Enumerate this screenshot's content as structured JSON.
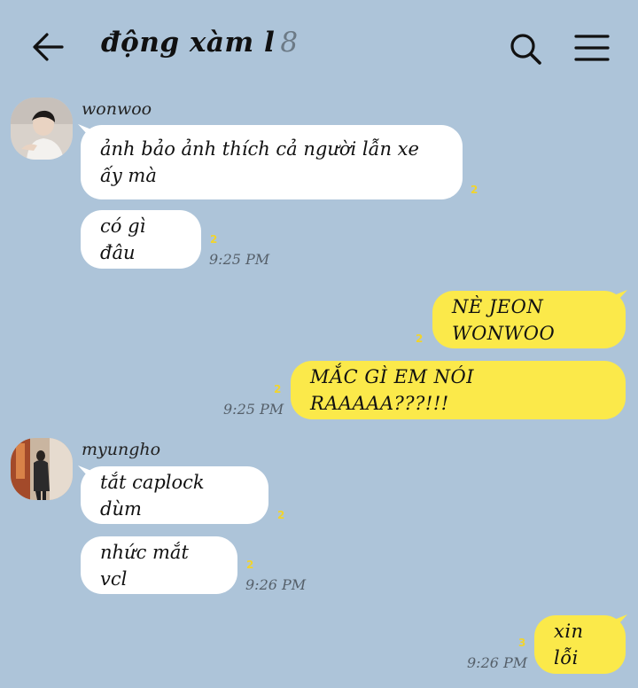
{
  "header": {
    "title": "động xàm l",
    "member_count": "8"
  },
  "users": {
    "wonwoo": "wonwoo",
    "myungho": "myungho"
  },
  "messages": {
    "m1": {
      "text": "ảnh bảo ảnh thích cả người lẫn xe ấy mà",
      "unread": "2"
    },
    "m2": {
      "text": "có gì đâu",
      "unread": "2",
      "time": "9:25 PM"
    },
    "m3": {
      "text": "NÈ JEON WONWOO",
      "unread": "2"
    },
    "m4": {
      "text": "MẮC GÌ EM NÓI RAAAAA???!!!",
      "unread": "2",
      "time": "9:25 PM"
    },
    "m5": {
      "text": "tắt caplock dùm",
      "unread": "2"
    },
    "m6": {
      "text": "nhức mắt vcl",
      "unread": "2",
      "time": "9:26 PM"
    },
    "m7": {
      "text": "xin lỗi",
      "unread": "3",
      "time": "9:26 PM"
    }
  },
  "icons": {
    "back": "arrow-left-icon",
    "search": "search-icon",
    "menu": "hamburger-menu-icon"
  },
  "colors": {
    "background": "#adc4d9",
    "incoming_bubble": "#ffffff",
    "outgoing_bubble": "#fbe94a",
    "unread": "#f1d42d"
  }
}
